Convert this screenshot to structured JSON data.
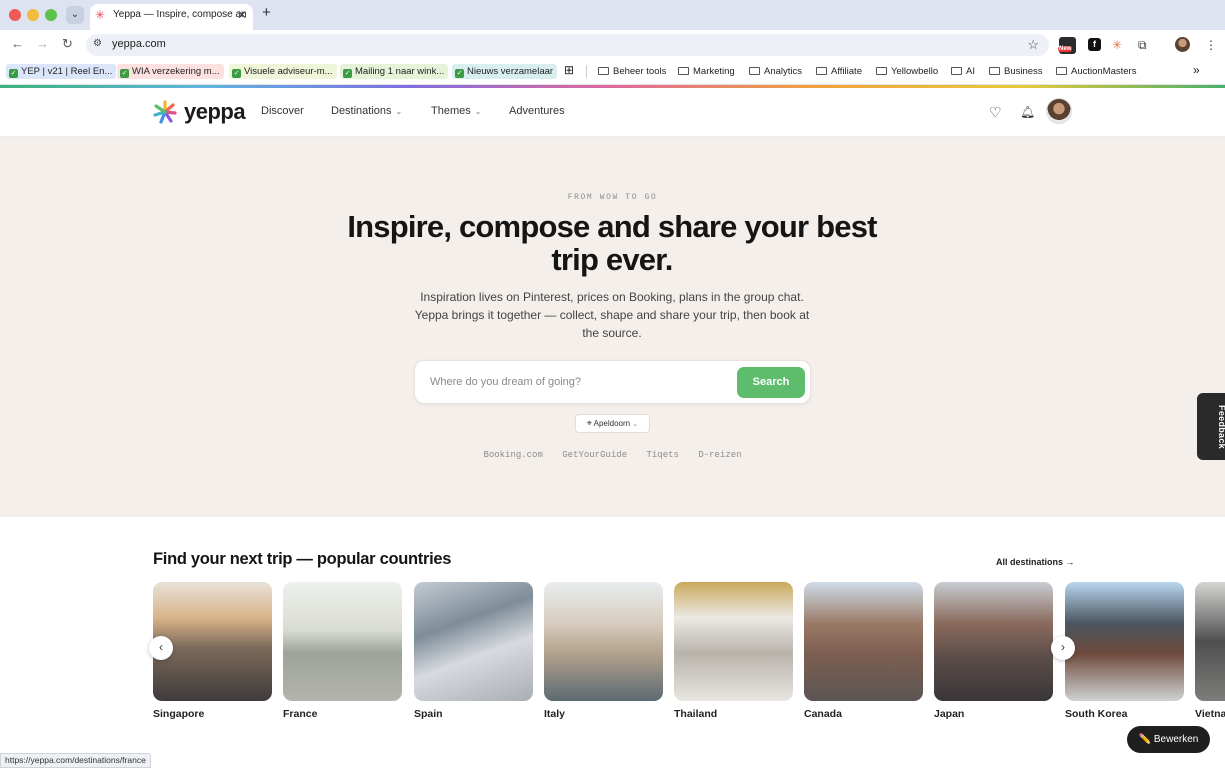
{
  "browser": {
    "tab_title": "Yeppa — Inspire, compose an",
    "url": "yeppa.com",
    "new_badge": "New",
    "bookmarks": [
      {
        "label": "YEP | v21 | Reel En...",
        "bg": "#dbe6fb"
      },
      {
        "label": "WIA verzekering m...",
        "bg": "#fde1e1"
      },
      {
        "label": "Visuele adviseur-m...",
        "bg": "#eef5d8"
      },
      {
        "label": "Mailing 1 naar wink...",
        "bg": "#e5f4d9"
      },
      {
        "label": "Nieuws verzamelaar",
        "bg": "#d9efef"
      }
    ],
    "bookmark_folders": [
      "Beheer tools",
      "Marketing",
      "Analytics",
      "Affiliate",
      "Yellowbello",
      "AI",
      "Business",
      "AuctionMasters"
    ]
  },
  "site": {
    "logo": "yeppa",
    "nav": {
      "discover": "Discover",
      "destinations": "Destinations",
      "themes": "Themes",
      "adventures": "Adventures"
    }
  },
  "hero": {
    "eyebrow": "FROM WOW TO GO",
    "title": "Inspire, compose and share your best trip ever.",
    "lead": "Inspiration lives on Pinterest, prices on Booking, plans in the group chat. Yeppa brings it together — collect, shape and share your trip, then book at the source.",
    "search_placeholder": "Where do you dream of going?",
    "search_button": "Search",
    "location": "Apeldoorn",
    "partners": [
      "Booking.com",
      "GetYourGuide",
      "Tiqets",
      "D-reizen"
    ]
  },
  "feedback_label": "Feedback",
  "countries_section": {
    "title": "Find your next trip — popular countries",
    "all_link": "All destinations →",
    "countries": [
      "Singapore",
      "France",
      "Spain",
      "Italy",
      "Thailand",
      "Canada",
      "Japan",
      "South Korea",
      "Vietna"
    ]
  },
  "status_url": "https://yeppa.com/destinations/france",
  "edit_button": "✏️ Bewerken"
}
